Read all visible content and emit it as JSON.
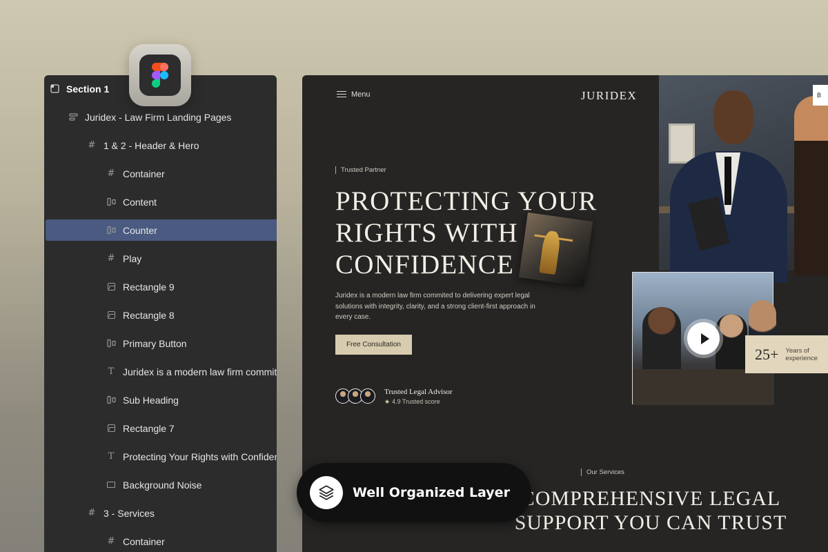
{
  "figma_icon": "figma-icon",
  "layers_panel": {
    "items": [
      {
        "label": "Section 1",
        "icon": "section-icon",
        "indent": 0,
        "type": "section"
      },
      {
        "label": "Juridex - Law Firm Landing Pages",
        "icon": "auto-layout-icon",
        "indent": 1
      },
      {
        "label": "1 & 2 - Header & Hero",
        "icon": "frame-icon",
        "indent": 2
      },
      {
        "label": "Container",
        "icon": "frame-icon",
        "indent": 3
      },
      {
        "label": "Content",
        "icon": "horizontal-layout-icon",
        "indent": 3
      },
      {
        "label": "Counter",
        "icon": "horizontal-layout-icon",
        "indent": 3,
        "selected": true
      },
      {
        "label": "Play",
        "icon": "frame-icon",
        "indent": 3
      },
      {
        "label": "Rectangle 9",
        "icon": "image-icon",
        "indent": 3
      },
      {
        "label": "Rectangle 8",
        "icon": "image-icon",
        "indent": 3
      },
      {
        "label": "Primary Button",
        "icon": "horizontal-layout-icon",
        "indent": 3
      },
      {
        "label": "Juridex is a modern law firm commite",
        "icon": "text-icon",
        "indent": 3
      },
      {
        "label": "Sub Heading",
        "icon": "horizontal-layout-icon",
        "indent": 3
      },
      {
        "label": "Rectangle 7",
        "icon": "image-icon",
        "indent": 3
      },
      {
        "label": "Protecting Your Rights with Confidenc",
        "icon": "text-icon",
        "indent": 3
      },
      {
        "label": "Background Noise",
        "icon": "rectangle-icon",
        "indent": 3
      },
      {
        "label": "3 - Services",
        "icon": "frame-icon",
        "indent": 2
      },
      {
        "label": "Container",
        "icon": "frame-icon",
        "indent": 3
      }
    ]
  },
  "preview": {
    "menu_label": "Menu",
    "brand": "JURIDEX",
    "hero_sub_heading": "Trusted Partner",
    "hero_title_lines": [
      "PROTECTING YOUR",
      "RIGHTS WITH",
      "CONFIDENCE"
    ],
    "description": "Juridex is a modern law firm commited to delivering expert legal solutions with integrity, clarity, and a strong client-first approach in every case.",
    "cta_label": "Free Consultation",
    "trust_title": "Trusted Legal Advisor",
    "trust_score": "4.9 Trusted score",
    "top_button_label": "B",
    "counter_value": "25+",
    "counter_label_line1": "Years of",
    "counter_label_line2": "experience",
    "services_sub_heading": "Our Services",
    "services_title_lines": [
      "COMPREHENSIVE LEGAL",
      "SUPPORT YOU CAN TRUST"
    ]
  },
  "badge": {
    "label": "Well Organized Layer",
    "icon": "layers-icon"
  },
  "colors": {
    "selection": "#4a5a80",
    "panel_bg": "#2c2c2c",
    "preview_bg": "#262524",
    "accent_beige": "#d8ccb0"
  }
}
